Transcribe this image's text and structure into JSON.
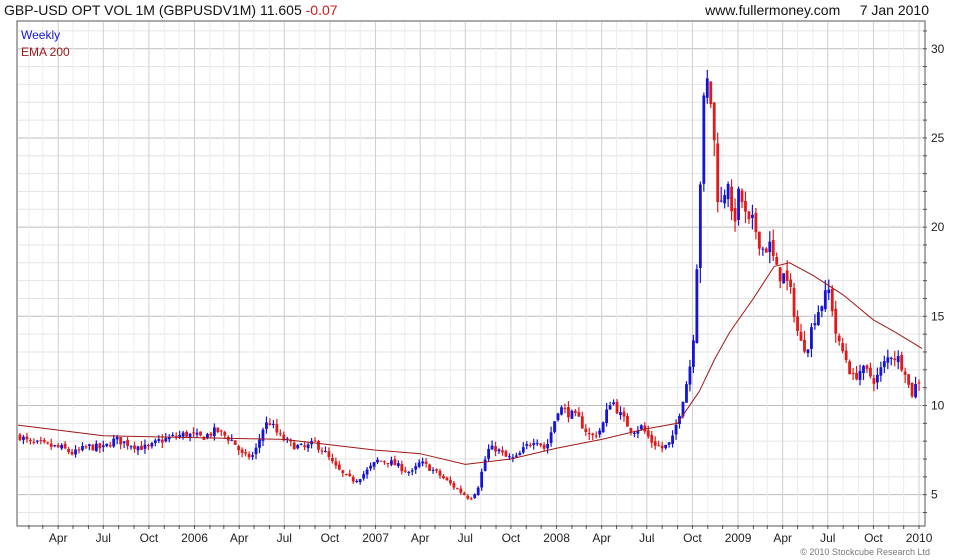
{
  "header": {
    "symbol_text": "GBP-USD OPT VOL 1M (GBPUSDV1M)",
    "last": "11.605",
    "change": "-0.07",
    "site": "www.fullermoney.com",
    "date": "7 Jan 2010"
  },
  "legend": {
    "weekly": "Weekly",
    "ema": "EMA 200"
  },
  "copyright": "© 2010 Stockcube Research Ltd",
  "colors": {
    "up": "#1414d6",
    "down": "#e01a1a",
    "ema": "#a01818",
    "grid": "#cfcfcf",
    "frame": "#555555"
  },
  "chart_data": {
    "type": "line",
    "title": "GBP-USD OPT VOL 1M (GBPUSDV1M)",
    "xlabel": "",
    "ylabel": "",
    "x_range": [
      "2005-01-10",
      "2010-01-11"
    ],
    "ylim": [
      3.3,
      31.5
    ],
    "y_ticks": [
      5,
      10,
      15,
      20,
      25,
      30
    ],
    "grid": true,
    "legend_position": "top-left",
    "x_ticks": [
      {
        "date": "2005-04-01",
        "label": "Apr"
      },
      {
        "date": "2005-07-01",
        "label": "Jul"
      },
      {
        "date": "2005-10-01",
        "label": "Oct"
      },
      {
        "date": "2006-01-01",
        "label": "2006"
      },
      {
        "date": "2006-04-01",
        "label": "Apr"
      },
      {
        "date": "2006-07-01",
        "label": "Jul"
      },
      {
        "date": "2006-10-01",
        "label": "Oct"
      },
      {
        "date": "2007-01-01",
        "label": "2007"
      },
      {
        "date": "2007-04-01",
        "label": "Apr"
      },
      {
        "date": "2007-07-01",
        "label": "Jul"
      },
      {
        "date": "2007-10-01",
        "label": "Oct"
      },
      {
        "date": "2008-01-01",
        "label": "2008"
      },
      {
        "date": "2008-04-01",
        "label": "Apr"
      },
      {
        "date": "2008-07-01",
        "label": "Jul"
      },
      {
        "date": "2008-10-01",
        "label": "Oct"
      },
      {
        "date": "2009-01-01",
        "label": "2009"
      },
      {
        "date": "2009-04-01",
        "label": "Apr"
      },
      {
        "date": "2009-07-01",
        "label": "Jul"
      },
      {
        "date": "2009-10-01",
        "label": "Oct"
      },
      {
        "date": "2010-01-01",
        "label": "2010"
      }
    ],
    "series": [
      {
        "name": "Weekly",
        "kind": "close",
        "points": [
          [
            "2005-01-14",
            8.3
          ],
          [
            "2005-02-01",
            7.9
          ],
          [
            "2005-03-01",
            7.8
          ],
          [
            "2005-03-20",
            7.7
          ],
          [
            "2005-04-10",
            7.6
          ],
          [
            "2005-05-01",
            7.3
          ],
          [
            "2005-06-01",
            7.7
          ],
          [
            "2005-07-01",
            7.6
          ],
          [
            "2005-07-25",
            8.1
          ],
          [
            "2005-08-15",
            7.9
          ],
          [
            "2005-09-10",
            7.7
          ],
          [
            "2005-10-01",
            7.6
          ],
          [
            "2005-10-20",
            8.0
          ],
          [
            "2005-11-15",
            8.2
          ],
          [
            "2005-12-15",
            8.4
          ],
          [
            "2006-01-15",
            8.2
          ],
          [
            "2006-02-15",
            8.6
          ],
          [
            "2006-03-20",
            8.0
          ],
          [
            "2006-04-10",
            7.1
          ],
          [
            "2006-05-01",
            7.2
          ],
          [
            "2006-05-20",
            8.8
          ],
          [
            "2006-06-01",
            9.1
          ],
          [
            "2006-06-20",
            8.3
          ],
          [
            "2006-07-15",
            7.8
          ],
          [
            "2006-08-10",
            7.6
          ],
          [
            "2006-09-01",
            7.9
          ],
          [
            "2006-09-20",
            7.4
          ],
          [
            "2006-10-10",
            6.6
          ],
          [
            "2006-11-01",
            6.0
          ],
          [
            "2006-11-20",
            5.8
          ],
          [
            "2006-12-10",
            6.2
          ],
          [
            "2007-01-05",
            6.9
          ],
          [
            "2007-01-25",
            6.9
          ],
          [
            "2007-02-15",
            6.6
          ],
          [
            "2007-03-15",
            6.2
          ],
          [
            "2007-04-01",
            6.8
          ],
          [
            "2007-04-20",
            6.5
          ],
          [
            "2007-05-10",
            6.1
          ],
          [
            "2007-06-01",
            5.6
          ],
          [
            "2007-06-20",
            5.2
          ],
          [
            "2007-07-10",
            4.8
          ],
          [
            "2007-07-25",
            5.3
          ],
          [
            "2007-08-15",
            7.5
          ],
          [
            "2007-09-01",
            7.6
          ],
          [
            "2007-09-20",
            7.1
          ],
          [
            "2007-10-10",
            7.0
          ],
          [
            "2007-11-01",
            7.7
          ],
          [
            "2007-11-20",
            8.2
          ],
          [
            "2007-12-10",
            7.5
          ],
          [
            "2008-01-05",
            9.9
          ],
          [
            "2008-01-25",
            9.6
          ],
          [
            "2008-02-15",
            9.2
          ],
          [
            "2008-03-10",
            8.2
          ],
          [
            "2008-04-01",
            8.7
          ],
          [
            "2008-04-20",
            10.4
          ],
          [
            "2008-05-10",
            9.4
          ],
          [
            "2008-06-01",
            8.6
          ],
          [
            "2008-06-20",
            8.8
          ],
          [
            "2008-07-10",
            8.0
          ],
          [
            "2008-08-01",
            7.6
          ],
          [
            "2008-08-20",
            7.9
          ],
          [
            "2008-09-10",
            10.2
          ],
          [
            "2008-09-25",
            12.0
          ],
          [
            "2008-10-05",
            14.5
          ],
          [
            "2008-10-15",
            21.5
          ],
          [
            "2008-10-24",
            26.8
          ],
          [
            "2008-11-01",
            28.2
          ],
          [
            "2008-11-10",
            26.5
          ],
          [
            "2008-11-20",
            22.0
          ],
          [
            "2008-12-01",
            21.0
          ],
          [
            "2008-12-10",
            23.5
          ],
          [
            "2008-12-20",
            20.0
          ],
          [
            "2009-01-05",
            22.0
          ],
          [
            "2009-01-20",
            20.0
          ],
          [
            "2009-02-01",
            20.2
          ],
          [
            "2009-02-20",
            18.8
          ],
          [
            "2009-03-05",
            19.0
          ],
          [
            "2009-03-20",
            17.5
          ],
          [
            "2009-04-05",
            17.2
          ],
          [
            "2009-04-20",
            16.0
          ],
          [
            "2009-05-05",
            13.5
          ],
          [
            "2009-05-20",
            13.3
          ],
          [
            "2009-06-05",
            15.0
          ],
          [
            "2009-06-20",
            15.8
          ],
          [
            "2009-07-05",
            16.5
          ],
          [
            "2009-07-20",
            13.5
          ],
          [
            "2009-08-05",
            12.8
          ],
          [
            "2009-08-20",
            11.5
          ],
          [
            "2009-09-05",
            12.0
          ],
          [
            "2009-09-20",
            11.8
          ],
          [
            "2009-10-05",
            11.4
          ],
          [
            "2009-10-20",
            12.2
          ],
          [
            "2009-11-05",
            12.9
          ],
          [
            "2009-11-20",
            12.6
          ],
          [
            "2009-12-05",
            12.0
          ],
          [
            "2009-12-15",
            10.5
          ],
          [
            "2009-12-28",
            11.3
          ],
          [
            "2010-01-07",
            11.6
          ]
        ]
      },
      {
        "name": "EMA 200",
        "kind": "ema",
        "points": [
          [
            "2005-01-10",
            8.9
          ],
          [
            "2005-07-01",
            8.3
          ],
          [
            "2006-01-01",
            8.2
          ],
          [
            "2006-07-01",
            8.1
          ],
          [
            "2007-01-01",
            7.5
          ],
          [
            "2007-04-01",
            7.3
          ],
          [
            "2007-07-01",
            6.7
          ],
          [
            "2007-10-01",
            7.0
          ],
          [
            "2008-01-01",
            7.6
          ],
          [
            "2008-04-01",
            8.1
          ],
          [
            "2008-07-01",
            8.7
          ],
          [
            "2008-09-01",
            9.0
          ],
          [
            "2008-10-15",
            10.8
          ],
          [
            "2008-11-15",
            12.6
          ],
          [
            "2008-12-15",
            14.1
          ],
          [
            "2009-02-01",
            16.0
          ],
          [
            "2009-03-15",
            17.8
          ],
          [
            "2009-04-15",
            18.0
          ],
          [
            "2009-06-01",
            17.3
          ],
          [
            "2009-08-01",
            16.2
          ],
          [
            "2009-10-01",
            14.8
          ],
          [
            "2009-11-15",
            14.1
          ],
          [
            "2010-01-07",
            13.2
          ]
        ]
      }
    ]
  }
}
